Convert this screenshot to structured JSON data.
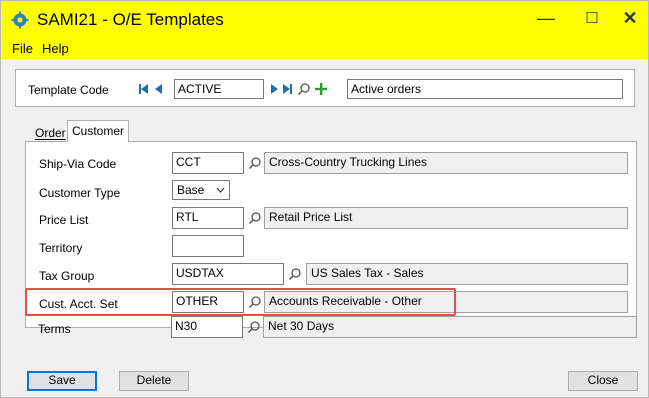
{
  "window": {
    "title": "SAMI21 - O/E Templates",
    "minimize": "—",
    "maximize": "☐",
    "close": "✕"
  },
  "menu": {
    "file": "File",
    "help": "Help"
  },
  "header": {
    "template_code_label": "Template Code",
    "template_code_value": "ACTIVE",
    "template_description": "Active orders"
  },
  "tabs": {
    "order": "Order",
    "customer": "Customer"
  },
  "fields": {
    "ship_via": {
      "label": "Ship-Via Code",
      "value": "CCT",
      "description": "Cross-Country Trucking Lines"
    },
    "customer_type": {
      "label": "Customer Type",
      "value": "Base"
    },
    "price_list": {
      "label": "Price List",
      "value": "RTL",
      "description": "Retail Price List"
    },
    "territory": {
      "label": "Territory",
      "value": ""
    },
    "tax_group": {
      "label": "Tax Group",
      "value": "USDTAX",
      "description": "US Sales Tax - Sales"
    },
    "acct_set": {
      "label": "Cust. Acct. Set",
      "value": "OTHER",
      "description": "Accounts Receivable - Other"
    },
    "terms": {
      "label": "Terms",
      "value": "N30",
      "description": "Net 30 Days"
    }
  },
  "buttons": {
    "save": "Save",
    "delete": "Delete",
    "close": "Close"
  },
  "colors": {
    "titlebar": "#ffff00",
    "highlight": "#e0514a",
    "nav_blue": "#1f6fb5",
    "plus_green": "#2ca02c"
  },
  "icons": [
    "settings-gear-icon",
    "first-record-icon",
    "previous-record-icon",
    "next-record-icon",
    "last-record-icon",
    "finder-icon",
    "new-icon",
    "chevron-down-icon"
  ]
}
